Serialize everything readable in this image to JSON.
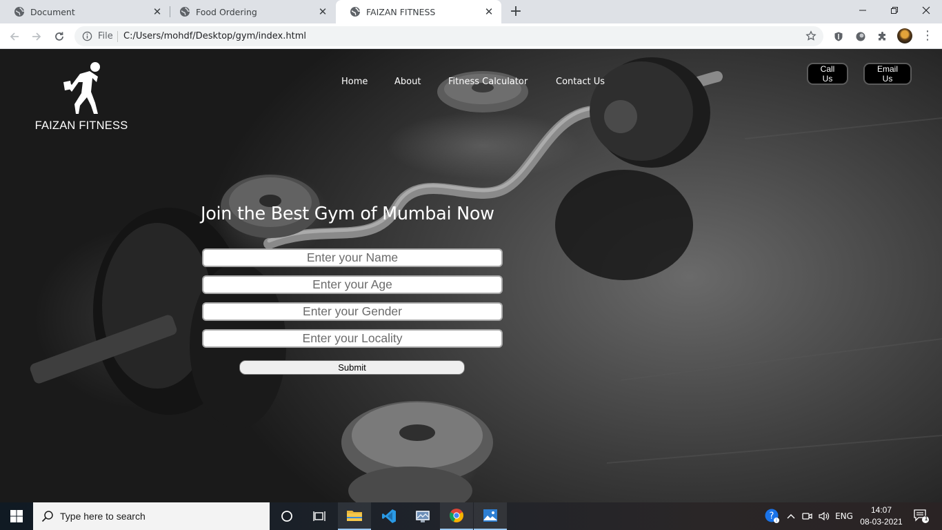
{
  "browser": {
    "tabs": [
      {
        "title": "Document",
        "close": "✕"
      },
      {
        "title": "Food Ordering",
        "close": "✕"
      },
      {
        "title": "FAIZAN FITNESS",
        "close": "✕",
        "active": true
      }
    ],
    "new_tab": "+",
    "address": {
      "scheme_label": "File",
      "url": "C:/Users/mohdf/Desktop/gym/index.html"
    }
  },
  "site": {
    "logo_text": "FAIZAN FITNESS",
    "nav": [
      "Home",
      "About",
      "Fitness Calculator",
      "Contact Us"
    ],
    "actions": {
      "call": "Call Us",
      "email": "Email Us"
    },
    "headline": "Join the Best Gym of Mumbai Now",
    "form": {
      "name_placeholder": "Enter your Name",
      "age_placeholder": "Enter your Age",
      "gender_placeholder": "Enter your Gender",
      "locality_placeholder": "Enter your Locality",
      "submit": "Submit"
    }
  },
  "taskbar": {
    "search_placeholder": "Type here to search",
    "language": "ENG",
    "time": "14:07",
    "date": "08-03-2021",
    "notification_count": "1"
  }
}
